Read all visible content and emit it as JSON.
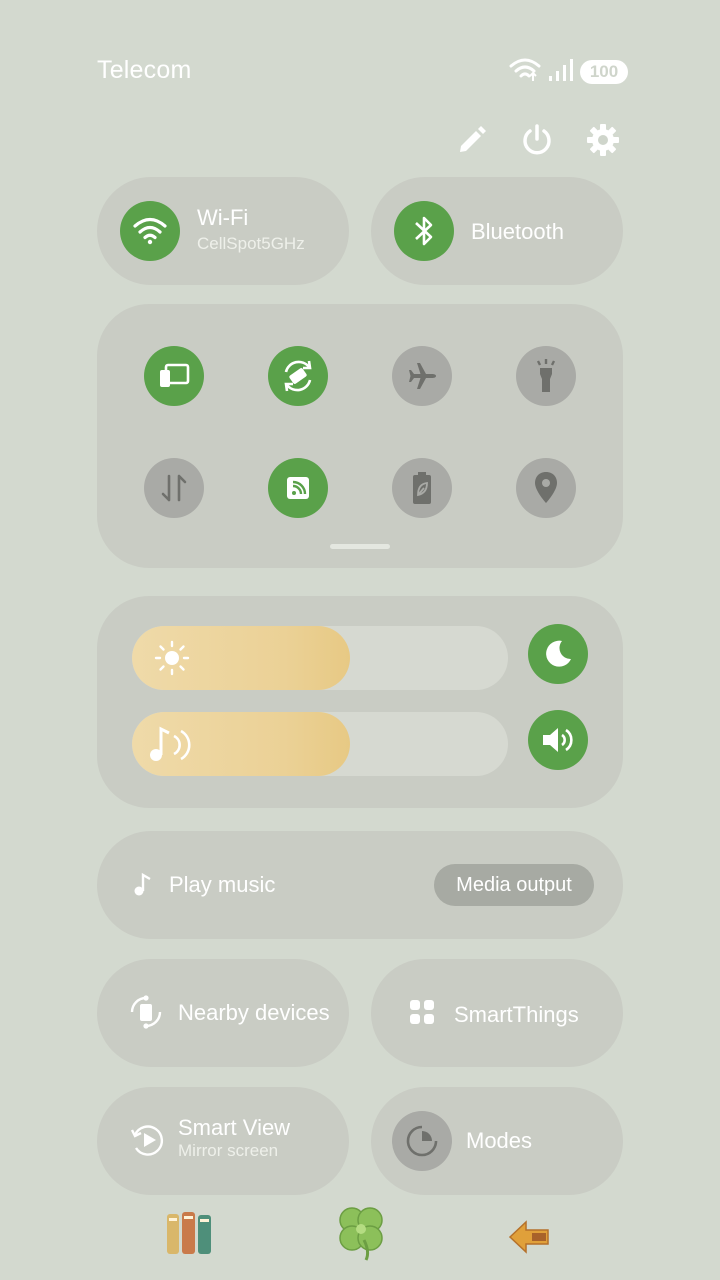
{
  "status_bar": {
    "carrier": "Telecom",
    "battery": "100",
    "icons": [
      "wifi-icon",
      "data-arrows-icon",
      "signal-icon",
      "battery-icon"
    ]
  },
  "top_actions": [
    "pencil-icon",
    "power-icon",
    "settings-icon"
  ],
  "wide_tiles": {
    "wifi": {
      "title": "Wi-Fi",
      "subtitle": "CellSpot5GHz",
      "state": "on"
    },
    "bluetooth": {
      "title": "Bluetooth",
      "state": "on"
    }
  },
  "quick_toggles": [
    {
      "icon": "screen-mirror-icon",
      "state": "on"
    },
    {
      "icon": "auto-rotate-icon",
      "state": "on"
    },
    {
      "icon": "airplane-icon",
      "state": "off"
    },
    {
      "icon": "flashlight-icon",
      "state": "off"
    },
    {
      "icon": "mobile-data-icon",
      "state": "off"
    },
    {
      "icon": "nfc-icon",
      "state": "on"
    },
    {
      "icon": "power-saving-icon",
      "state": "off"
    },
    {
      "icon": "location-icon",
      "state": "off"
    }
  ],
  "sliders": {
    "brightness": {
      "icon": "sun-icon",
      "level": 0.58
    },
    "volume": {
      "icon": "music-note-icon",
      "level": 0.58
    }
  },
  "slider_buttons": [
    "dark-mode-icon",
    "sound-mode-icon"
  ],
  "media": {
    "label": "Play music",
    "output_label": "Media output"
  },
  "bottom_tiles": {
    "nearby": {
      "label": "Nearby devices"
    },
    "smartthings": {
      "label": "SmartThings"
    },
    "smartview": {
      "label": "Smart View",
      "sublabel": "Mirror screen"
    },
    "modes": {
      "label": "Modes"
    }
  },
  "dock": [
    "books-icon",
    "clover-icon",
    "back-arrow-icon"
  ],
  "colors": {
    "accent": "#5aa14a",
    "inactive": "#a9aaa6",
    "panel": "#c9ccc4",
    "background": "#d3d9cf",
    "slider_fill": "#ebd196"
  }
}
